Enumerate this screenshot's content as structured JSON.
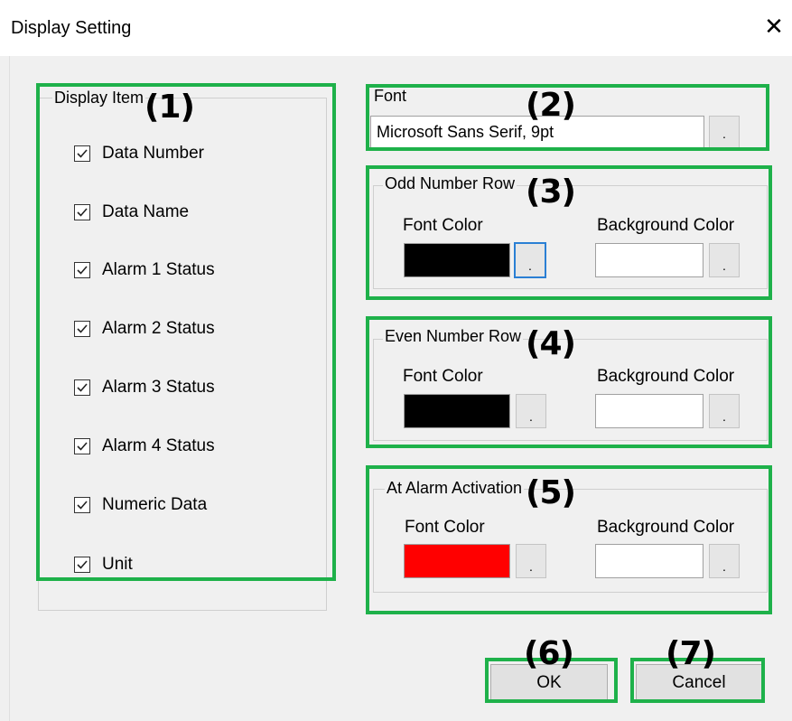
{
  "window": {
    "title": "Display Setting",
    "close_symbol": "✕"
  },
  "display_items": {
    "legend": "Display Item",
    "items": [
      {
        "label": "Data Number",
        "checked": true
      },
      {
        "label": "Data Name",
        "checked": true
      },
      {
        "label": "Alarm 1 Status",
        "checked": true
      },
      {
        "label": "Alarm 2 Status",
        "checked": true
      },
      {
        "label": "Alarm 3 Status",
        "checked": true
      },
      {
        "label": "Alarm 4 Status",
        "checked": true
      },
      {
        "label": "Numeric Data",
        "checked": true
      },
      {
        "label": "Unit",
        "checked": true
      }
    ]
  },
  "font": {
    "legend": "Font",
    "value": "Microsoft Sans Serif, 9pt",
    "button": "."
  },
  "odd_rows": {
    "legend": "Odd Number Row",
    "font_color_label": "Font Color",
    "font_color": "#000000",
    "bg_color_label": "Background Color",
    "bg_color": "#ffffff",
    "button": "."
  },
  "even_rows": {
    "legend": "Even Number Row",
    "font_color_label": "Font Color",
    "font_color": "#000000",
    "bg_color_label": "Background Color",
    "bg_color": "#ffffff",
    "button": "."
  },
  "alarm": {
    "legend": "At Alarm Activation",
    "font_color_label": "Font Color",
    "font_color": "#ff0000",
    "bg_color_label": "Background Color",
    "bg_color": "#ffffff",
    "button": "."
  },
  "buttons": {
    "ok": "OK",
    "cancel": "Cancel"
  },
  "annotations": [
    "(1)",
    "(2)",
    "(3)",
    "(4)",
    "(5)",
    "(6)",
    "(7)"
  ],
  "highlight_color": "#1eb14a"
}
